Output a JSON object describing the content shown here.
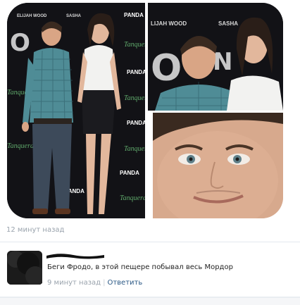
{
  "collage": {
    "left_photo": {
      "banner_names": [
        "ELIJAH WOOD",
        "SASHA"
      ],
      "banner_logo": "PANDA",
      "banner_brand": "Tanqueray"
    },
    "top_right_photo": {
      "banner_names": [
        "LIJAH WOOD",
        "SASHA"
      ]
    }
  },
  "post": {
    "time": "12 минут назад"
  },
  "comment": {
    "text": "Беги Фродо, в этой пещере побывал весь Мордор",
    "time": "9 минут назад",
    "separator": "|",
    "reply_label": "Ответить"
  },
  "colors": {
    "link": "#2a5885",
    "muted": "#9aa3ad",
    "backdrop": "#0f0f12"
  }
}
